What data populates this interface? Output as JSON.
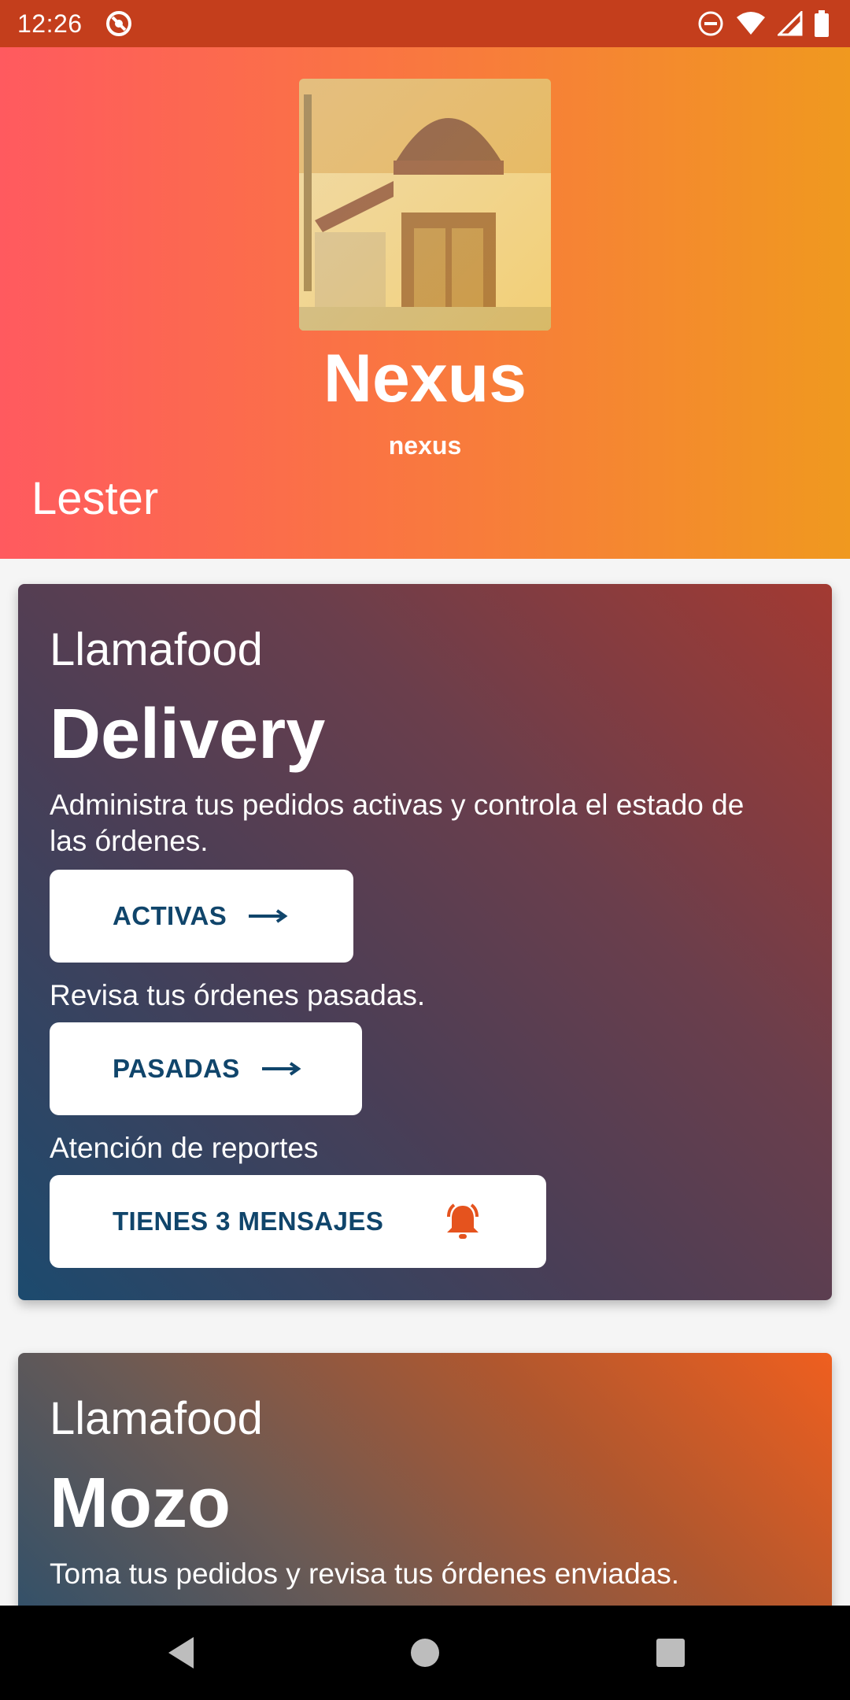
{
  "status_bar": {
    "time": "12:26",
    "icons": [
      "sync-icon",
      "do-not-disturb-icon",
      "wifi-icon",
      "signal-icon",
      "battery-icon"
    ]
  },
  "header": {
    "store_name": "Nexus",
    "store_slug": "nexus",
    "user_name": "Lester",
    "photo_icon": "storefront-photo"
  },
  "cards": {
    "delivery": {
      "brand": "Llamafood",
      "product": "Delivery",
      "description": "Administra tus pedidos activas y controla el estado de las órdenes.",
      "active_button": "ACTIVAS",
      "past_label": "Revisa tus órdenes pasadas.",
      "past_button": "PASADAS",
      "reports_label": "Atención de reportes",
      "messages_button": "TIENES 3 MENSAJES"
    },
    "mozo": {
      "brand": "Llamafood",
      "product": "Mozo",
      "description": "Toma tus pedidos y revisa tus órdenes enviadas."
    }
  },
  "nav_bar": {
    "icons": [
      "back-icon",
      "home-icon",
      "recents-icon"
    ]
  },
  "colors": {
    "status_bar": "#c43e1c",
    "button_text": "#10456b",
    "bell": "#e5531e"
  }
}
